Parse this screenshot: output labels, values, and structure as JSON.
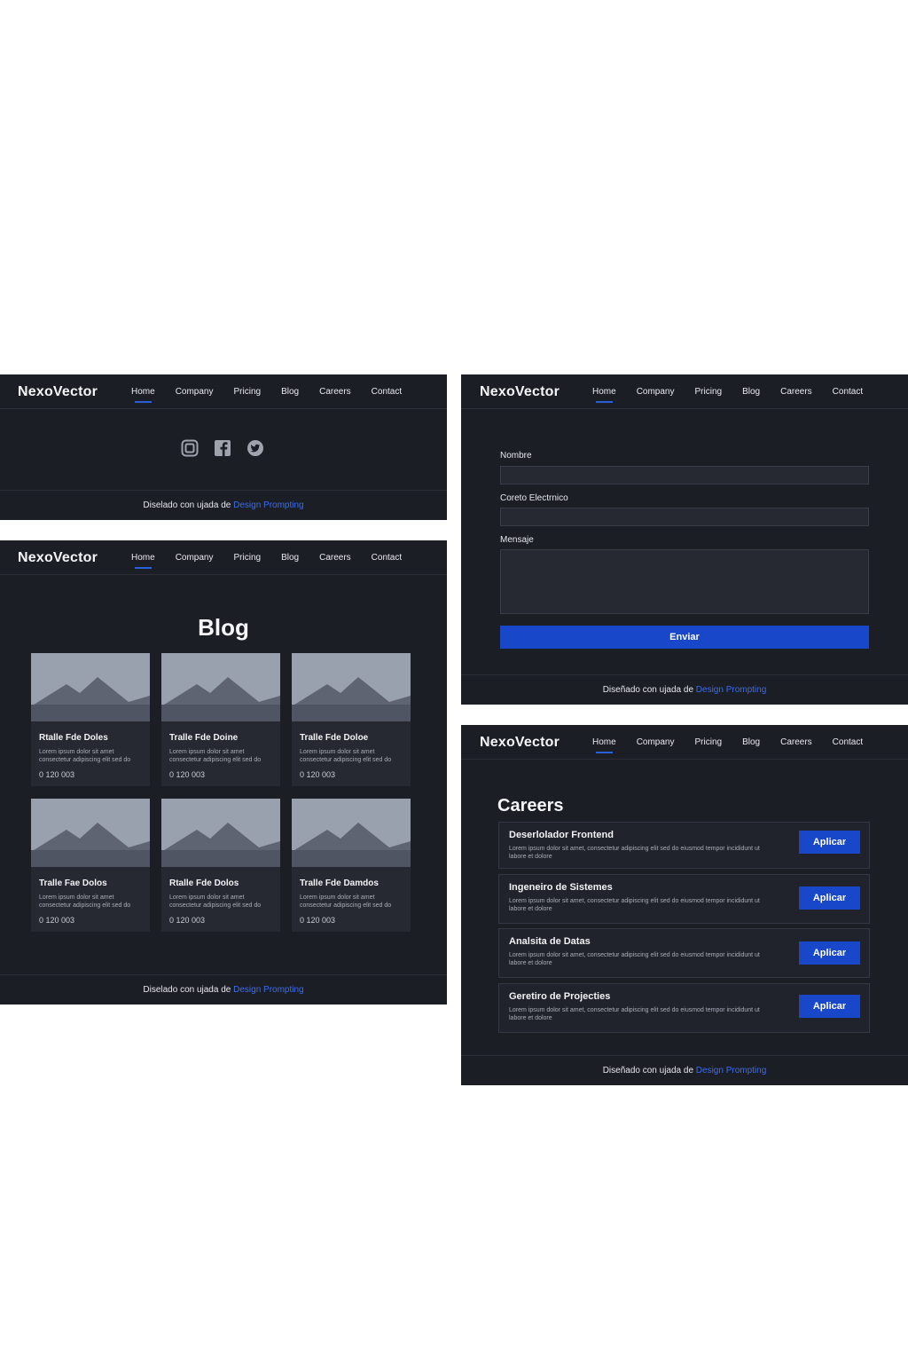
{
  "brand": "NexoVector",
  "nav": [
    "Home",
    "Company",
    "Pricing",
    "Blog",
    "Careers",
    "Contact"
  ],
  "footer": {
    "prefix_a": "Diseñado con ujada de",
    "prefix_b": "Diselado con ujada de",
    "link": "Design Prompting"
  },
  "social": [
    "instagram-icon",
    "facebook-icon",
    "twitter-icon"
  ],
  "blog": {
    "title": "Blog",
    "cards": [
      {
        "title": "Rtalle Fde Doles",
        "text": "Lorem ipsum dolor sit amet consectetur adipiscing elit sed do eiusmod",
        "num": "0 120 003"
      },
      {
        "title": "Tralle Fde Doine",
        "text": "Lorem ipsum dolor sit amet consectetur adipiscing elit sed do eiusmod",
        "num": "0 120 003"
      },
      {
        "title": "Tralle Fde Doloe",
        "text": "Lorem ipsum dolor sit amet consectetur adipiscing elit sed do eiusmod",
        "num": "0 120 003"
      },
      {
        "title": "Tralle Fae Dolos",
        "text": "Lorem ipsum dolor sit amet consectetur adipiscing elit sed do eiusmod",
        "num": "0 120 003"
      },
      {
        "title": "Rtalle Fde Dolos",
        "text": "Lorem ipsum dolor sit amet consectetur adipiscing elit sed do eiusmod",
        "num": "0 120 003"
      },
      {
        "title": "Tralle Fde Damdos",
        "text": "Lorem ipsum dolor sit amet consectetur adipiscing elit sed do eiusmod",
        "num": "0 120 003"
      }
    ]
  },
  "contact": {
    "name_label": "Nombre",
    "email_label": "Coreto Electrnico",
    "message_label": "Mensaje",
    "submit": "Enviar"
  },
  "careers": {
    "title": "Careers",
    "apply_label": "Aplicar",
    "jobs": [
      {
        "title": "Deserlolador Frontend",
        "desc": "Lorem ipsum dolor sit amet, consectetur adipiscing elit sed do eiusmod tempor incididunt ut labore et dolore"
      },
      {
        "title": "Ingeneiro de Sistemes",
        "desc": "Lorem ipsum dolor sit amet, consectetur adipiscing elit sed do eiusmod tempor incididunt ut labore et dolore"
      },
      {
        "title": "Analsita de Datas",
        "desc": "Lorem ipsum dolor sit amet, consectetur adipiscing elit sed do eiusmod tempor incididunt ut labore et dolore"
      },
      {
        "title": "Geretiro de Projecties",
        "desc": "Lorem ipsum dolor sit amet, consectetur adipiscing elit sed do eiusmod tempor incididunt ut labore et dolore"
      }
    ]
  },
  "colors": {
    "bg": "#1c1e25",
    "card": "#262932",
    "accent": "#1848c9",
    "link": "#3a6df0"
  }
}
